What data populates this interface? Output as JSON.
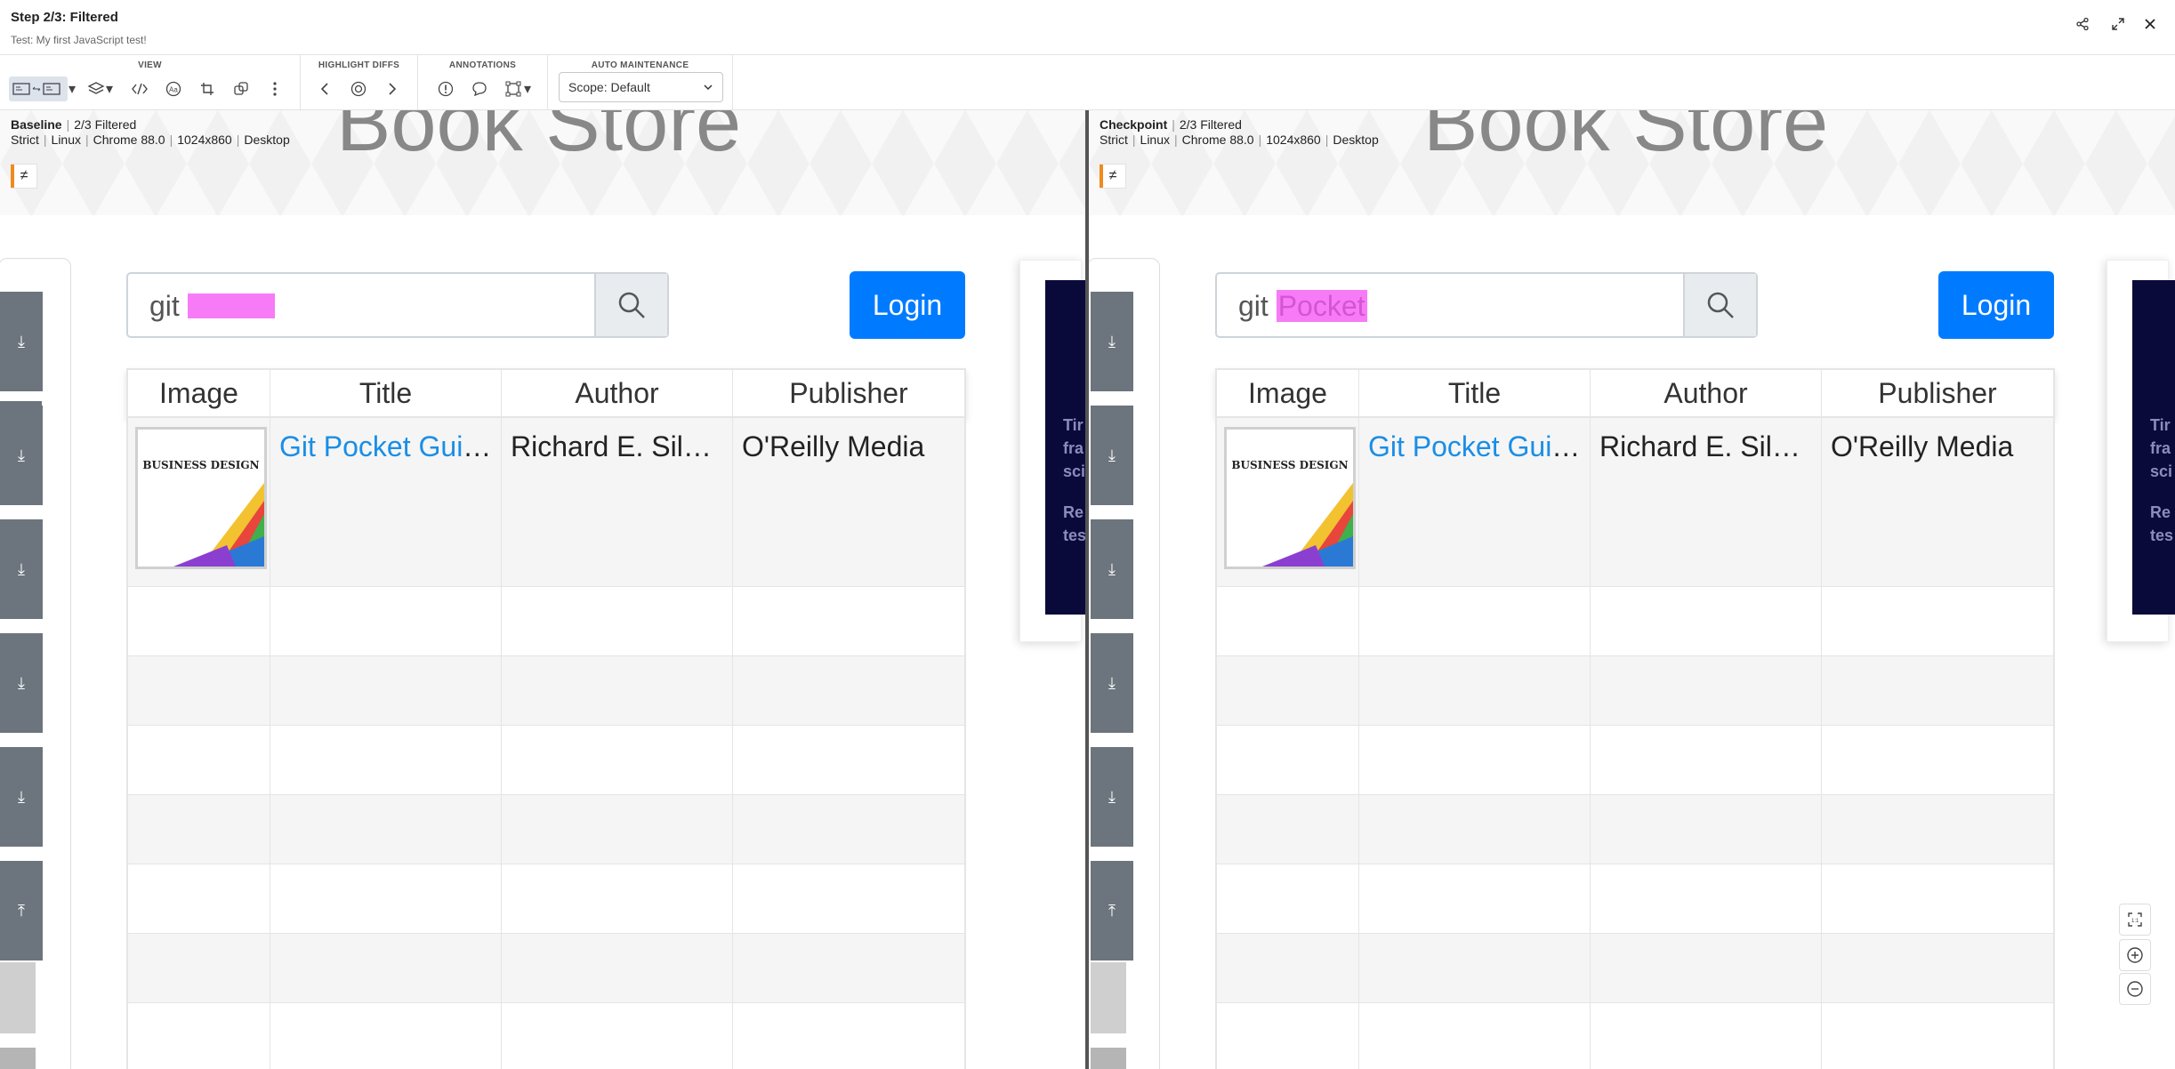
{
  "header": {
    "title": "Step 2/3: Filtered",
    "subtitle": "Test: My first JavaScript test!"
  },
  "toolbar": {
    "groups": [
      {
        "label": "VIEW"
      },
      {
        "label": "HIGHLIGHT DIFFS"
      },
      {
        "label": "ANNOTATIONS"
      },
      {
        "label": "AUTO MAINTENANCE"
      }
    ],
    "scope_select": "Scope: Default"
  },
  "baseline": {
    "label": "Baseline",
    "step": "2/3 Filtered",
    "meta": [
      "Strict",
      "Linux",
      "Chrome 88.0",
      "1024x860",
      "Desktop"
    ]
  },
  "checkpoint": {
    "label": "Checkpoint",
    "step": "2/3 Filtered",
    "meta": [
      "Strict",
      "Linux",
      "Chrome 88.0",
      "1024x860",
      "Desktop"
    ]
  },
  "app": {
    "banner_title": "Book Store",
    "login_label": "Login",
    "search_prefix": "git",
    "search_highlight": "Pocket",
    "neq_symbol": "≠",
    "table_headers": [
      "Image",
      "Title",
      "Author",
      "Publisher"
    ],
    "rows": [
      {
        "image": "BUSINESS DESIGN",
        "title": "Git Pocket Guide",
        "author": "Richard E. Sil…",
        "publisher": "O'Reilly Media"
      }
    ],
    "ad_text": [
      "Tir",
      "fra",
      "sci",
      "",
      "Re",
      "tes"
    ]
  },
  "colors": {
    "login": "#007bff",
    "diff_highlight": "#f77bf7",
    "link": "#1a8ee6",
    "accent_orange": "#f08a1e"
  }
}
